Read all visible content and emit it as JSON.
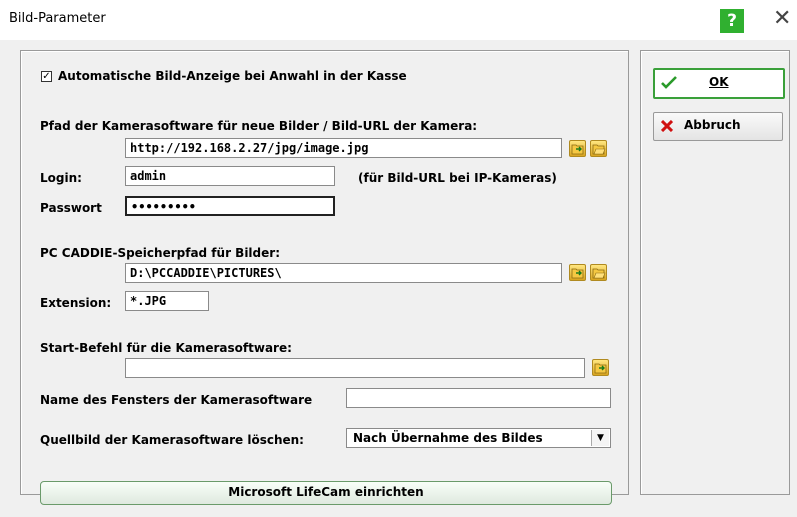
{
  "window": {
    "title": "Bild-Parameter",
    "help_label": "?",
    "close_label": "✕"
  },
  "auto_display": {
    "checked": true,
    "label": "Automatische Bild-Anzeige bei Anwahl in der Kasse"
  },
  "camera_path": {
    "label": "Pfad der Kamerasoftware für neue Bilder / Bild-URL der Kamera:",
    "value": "http://192.168.2.27/jpg/image.jpg"
  },
  "login": {
    "label": "Login:",
    "value": "admin",
    "hint": "(für Bild-URL bei IP-Kameras)"
  },
  "password": {
    "label": "Passwort",
    "value": "•••••••••"
  },
  "storage_path": {
    "label": "PC CADDIE-Speicherpfad für Bilder:",
    "value": "D:\\PCCADDIE\\PICTURES\\"
  },
  "extension": {
    "label": "Extension:",
    "value": "*.JPG"
  },
  "start_command": {
    "label": "Start-Befehl für die Kamerasoftware:",
    "value": ""
  },
  "window_name": {
    "label": "Name des Fensters der Kamerasoftware",
    "value": ""
  },
  "delete_source": {
    "label": "Quellbild der Kamerasoftware löschen:",
    "selected": "Nach Übernahme des Bildes"
  },
  "lifecam_button": "Microsoft LifeCam einrichten",
  "buttons": {
    "ok_label": "OK",
    "cancel_label": "Abbruch"
  },
  "icons": [
    "browse-folder-icon",
    "open-folder-icon",
    "checkmark-icon",
    "red-x-icon"
  ],
  "colors": {
    "help_bg": "#30b030",
    "ok_border": "#3aa03a",
    "cancel_icon": "#d01010"
  }
}
